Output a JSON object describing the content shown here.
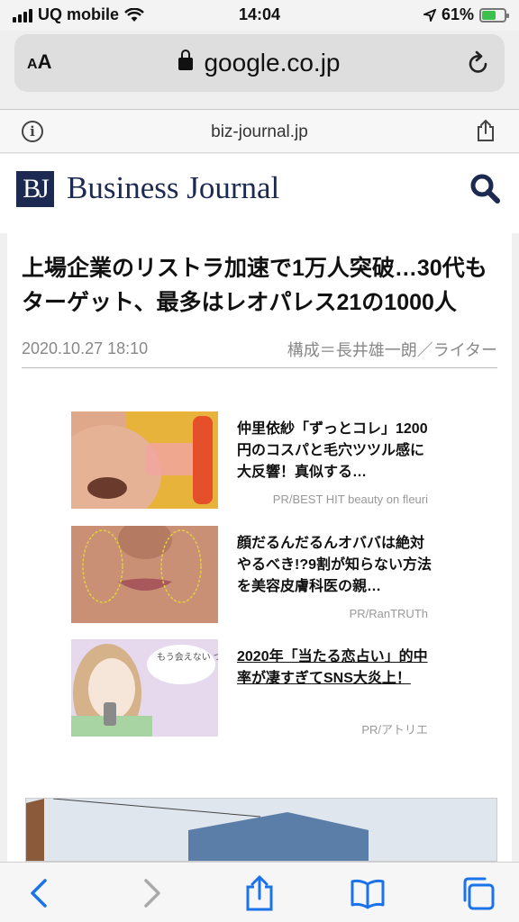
{
  "status": {
    "carrier": "UQ mobile",
    "time": "14:04",
    "battery": "61%"
  },
  "urlbar": {
    "aa_small": "A",
    "aa_large": "A",
    "url": "google.co.jp"
  },
  "sitebar": {
    "domain": "biz-journal.jp"
  },
  "header": {
    "logo_mark": "BJ",
    "logo_text": "Business Journal"
  },
  "article": {
    "title": "上場企業のリストラ加速で1万人突破…30代もターゲット、最多はレオパレス21の1000人",
    "date": "2020.10.27 18:10",
    "author": "構成＝長井雄一朗／ライター"
  },
  "ads": [
    {
      "text": "仲里依紗「ずっとコレ」1200円のコスパと毛穴ツツル感に大反響！真似する…",
      "source": "PR/BEST HIT beauty on fleuri"
    },
    {
      "text": "顔だるんだるんオババは絶対やるべき!?9割が知らない方法を美容皮膚科医の親…",
      "source": "PR/RanTRUTh"
    },
    {
      "text": "2020年「当たる恋占い」的中率が凄すぎてSNS大炎上！",
      "source": "PR/アトリエ",
      "thumb_caption": "もう会えない つらい。。。"
    }
  ]
}
